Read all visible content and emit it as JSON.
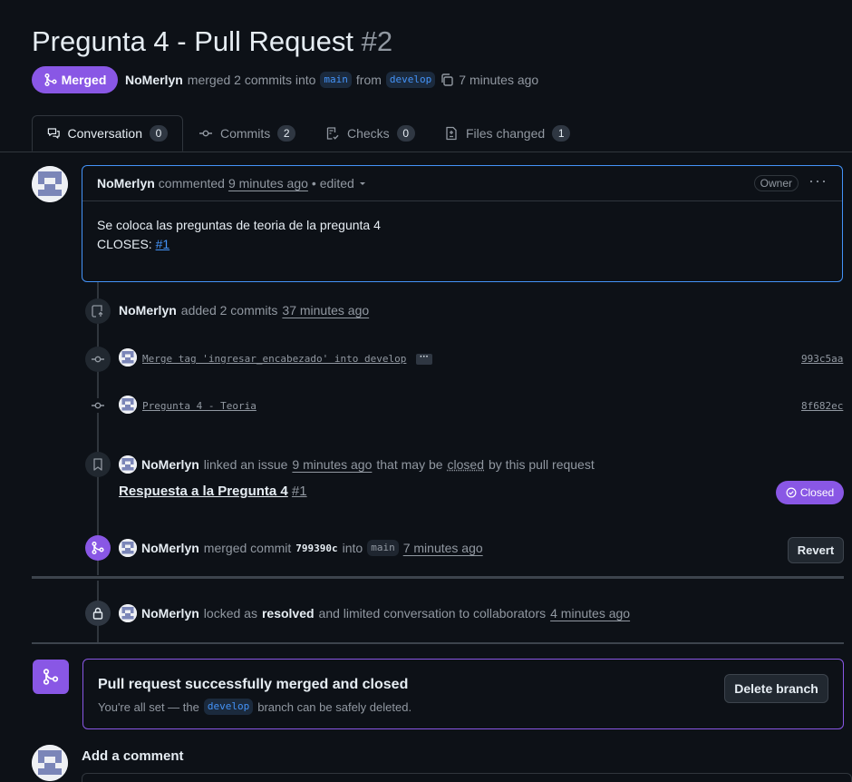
{
  "header": {
    "title": "Pregunta 4 - Pull Request",
    "number": "#2",
    "state_label": "Merged",
    "author": "NoMerlyn",
    "merged_text": "merged 2 commits into",
    "base_branch": "main",
    "from_text": "from",
    "head_branch": "develop",
    "time": "7 minutes ago"
  },
  "tabs": [
    {
      "label": "Conversation",
      "count": "0"
    },
    {
      "label": "Commits",
      "count": "2"
    },
    {
      "label": "Checks",
      "count": "0"
    },
    {
      "label": "Files changed",
      "count": "1"
    }
  ],
  "comment": {
    "author": "NoMerlyn",
    "action": "commented",
    "time": "9 minutes ago",
    "edited": "• edited",
    "role": "Owner",
    "body_line1": "Se coloca las preguntas de teoria de la pregunta 4",
    "body_prefix": "CLOSES:",
    "body_link": "#1"
  },
  "timeline": {
    "commits_event": {
      "author": "NoMerlyn",
      "text": "added 2 commits",
      "time": "37 minutes ago"
    },
    "commits": [
      {
        "message": "Merge tag 'ingresar_encabezado' into develop",
        "sha": "993c5aa",
        "has_more": true
      },
      {
        "message": "Pregunta 4 - Teoria",
        "sha": "8f682ec",
        "has_more": false
      }
    ],
    "linked_event": {
      "author": "NoMerlyn",
      "text1": "linked an issue",
      "time": "9 minutes ago",
      "text2": "that may be",
      "closed_word": "closed",
      "text3": "by this pull request",
      "issue_title": "Respuesta a la Pregunta 4",
      "issue_number": "#1",
      "issue_state": "Closed"
    },
    "merged_event": {
      "author": "NoMerlyn",
      "text1": "merged commit",
      "sha": "799390c",
      "text2": "into",
      "branch": "main",
      "time": "7 minutes ago",
      "revert_label": "Revert"
    },
    "locked_event": {
      "author": "NoMerlyn",
      "text1": "locked as",
      "reason": "resolved",
      "text2": "and limited conversation to collaborators",
      "time": "4 minutes ago"
    }
  },
  "merge_status": {
    "title": "Pull request successfully merged and closed",
    "desc1": "You're all set — the",
    "branch": "develop",
    "desc2": "branch can be safely deleted.",
    "delete_label": "Delete branch"
  },
  "add_comment": {
    "title": "Add a comment"
  },
  "colors": {
    "merged": "#8957e5",
    "link": "#4493f8",
    "background": "#0d1117"
  }
}
